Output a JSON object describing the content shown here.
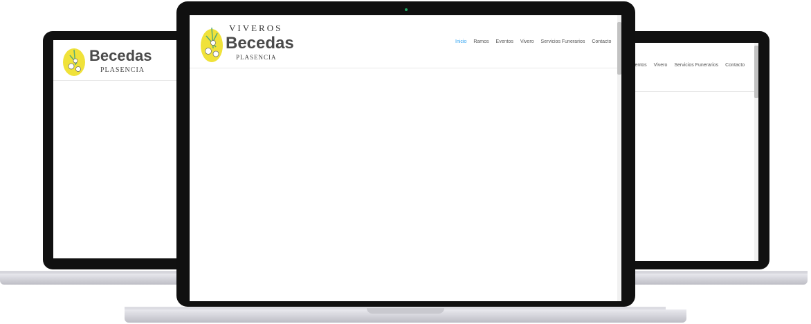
{
  "site": {
    "brand_top": "VIVEROS",
    "brand_main": "Becedas",
    "brand_sub": "PLASENCIA"
  },
  "nav": {
    "items": [
      {
        "label": "Inicio",
        "active": true
      },
      {
        "label": "Ramos"
      },
      {
        "label": "Eventos"
      },
      {
        "label": "Vivero"
      },
      {
        "label": "Servicios Funerarios"
      },
      {
        "label": "Contacto"
      }
    ],
    "right_partial_first": "ventos"
  },
  "colors": {
    "accent": "#2ea3f2",
    "logo_yellow": "#f0e23a",
    "bezel": "#111111"
  },
  "icons": {
    "logo": "flower-logo-icon",
    "camera": "camera-icon"
  }
}
